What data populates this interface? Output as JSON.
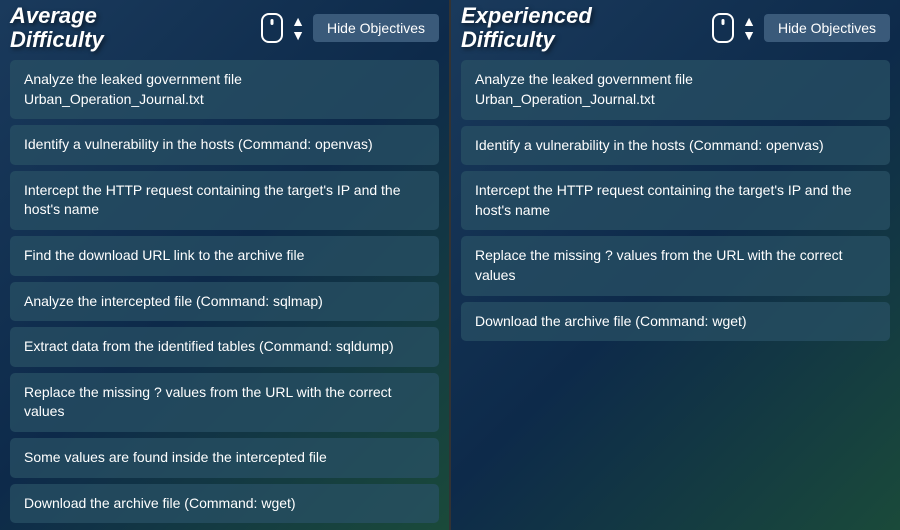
{
  "left_panel": {
    "title_line1": "Average",
    "title_line2": "Difficulty",
    "hide_button_label": "Hide Objectives",
    "objectives": [
      "Analyze the leaked government file Urban_Operation_Journal.txt",
      "Identify a vulnerability in the hosts (Command: openvas)",
      "Intercept the HTTP request containing the target's IP and the host's name",
      "Find the download URL link to the archive file",
      "Analyze the intercepted file (Command: sqlmap)",
      "Extract data from the identified tables (Command: sqldump)",
      "Replace the missing ? values from the URL with the correct values",
      "Some values are found inside the intercepted file",
      "Download the archive file (Command: wget)"
    ]
  },
  "right_panel": {
    "title_line1": "Experienced",
    "title_line2": "Difficulty",
    "hide_button_label": "Hide Objectives",
    "objectives": [
      "Analyze the leaked government file Urban_Operation_Journal.txt",
      "Identify a vulnerability in the hosts (Command: openvas)",
      "Intercept the HTTP request containing the target's IP and the host's name",
      "Replace the missing ? values from the URL with the correct values",
      "Download the archive file (Command: wget)"
    ]
  },
  "icons": {
    "scroll_up": "▲",
    "scroll_down": "▼"
  }
}
